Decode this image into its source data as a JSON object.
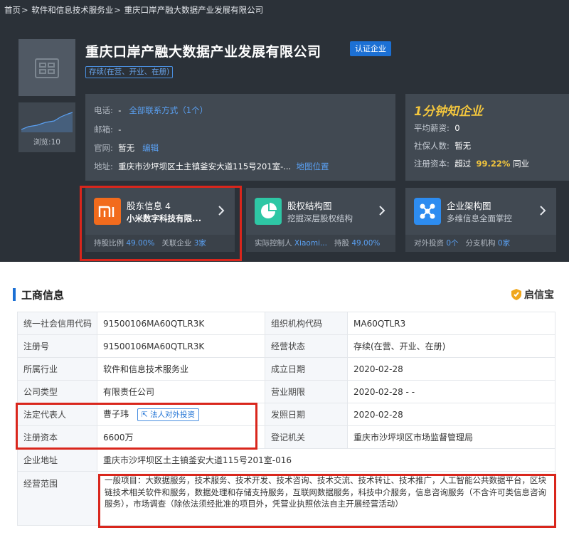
{
  "breadcrumb": {
    "home": "首页",
    "industry": "软件和信息技术服务业",
    "company": "重庆口岸产融大数据产业发展有限公司",
    "separator": ">"
  },
  "company": {
    "name": "重庆口岸产融大数据产业发展有限公司",
    "cert_badge": "认证企业",
    "status": "存续(在营、开业、在册)",
    "views": "浏览:10"
  },
  "contact": {
    "phone_label": "电话:",
    "phone_value": "-",
    "phone_link": "全部联系方式（1个）",
    "email_label": "邮箱:",
    "email_value": "-",
    "website_label": "官网:",
    "website_value": "暂无",
    "website_edit": "编辑",
    "address_label": "地址:",
    "address_value": "重庆市沙坪坝区土主镇釜安大道115号201室-...",
    "map_link": "地图位置"
  },
  "quick_know": {
    "brand": "1分钟知企业",
    "avg_salary_label": "平均薪资:",
    "avg_salary_value": "0",
    "insured_label": "社保人数:",
    "insured_value": "暂无",
    "capital_label": "注册资本:",
    "capital_prefix": "超过",
    "capital_percent": "99.22%",
    "capital_suffix": "同业"
  },
  "cards": {
    "shareholder": {
      "title": "股东信息 4",
      "sub": "小米数字科技有限...",
      "foot_label1": "持股比例",
      "foot_value1": "49.00%",
      "foot_label2": "关联企业",
      "foot_value2": "3家"
    },
    "equity": {
      "title": "股权结构图",
      "sub": "挖掘深层股权结构",
      "foot_label1": "实际控制人",
      "foot_value1": "Xiaomi...",
      "foot_label2": "持股",
      "foot_value2": "49.00%"
    },
    "structure": {
      "title": "企业架构图",
      "sub": "多维信息全面掌控",
      "foot_label1": "对外投资",
      "foot_value1": "0个",
      "foot_label2": "分支机构",
      "foot_value2": "0家"
    }
  },
  "business_info": {
    "title": "工商信息",
    "brand": "启信宝",
    "invest_button": "法人对外投资",
    "rows": [
      {
        "k1": "统一社会信用代码",
        "v1": "91500106MA60QTLR3K",
        "k2": "组织机构代码",
        "v2": "MA60QTLR3"
      },
      {
        "k1": "注册号",
        "v1": "91500106MA60QTLR3K",
        "k2": "经营状态",
        "v2": "存续(在营、开业、在册)"
      },
      {
        "k1": "所属行业",
        "v1": "软件和信息技术服务业",
        "k2": "成立日期",
        "v2": "2020-02-28"
      },
      {
        "k1": "公司类型",
        "v1": "有限责任公司",
        "k2": "营业期限",
        "v2": "2020-02-28 - -"
      },
      {
        "k1": "法定代表人",
        "v1": "曹子玮",
        "k2": "发照日期",
        "v2": "2020-02-28"
      },
      {
        "k1": "注册资本",
        "v1": "6600万",
        "k2": "登记机关",
        "v2": "重庆市沙坪坝区市场监督管理局"
      }
    ],
    "address_label": "企业地址",
    "address_value": "重庆市沙坪坝区土主镇釜安大道115号201室-016",
    "scope_label": "经营范围",
    "scope_value": "一般项目：大数据服务，技术服务、技术开发、技术咨询、技术交流、技术转让、技术推广，人工智能公共数据平台，区块链技术相关软件和服务，数据处理和存储支持服务，互联网数据服务，科技中介服务，信息咨询服务（不含许可类信息咨询服务），市场调查（除依法须经批准的项目外，凭营业执照依法自主开展经营活动）"
  },
  "colors": {
    "header_bg": "#2b3138",
    "accent_blue": "#1c70d4",
    "highlight_red": "#d9261c",
    "gold": "#f3c63d"
  }
}
